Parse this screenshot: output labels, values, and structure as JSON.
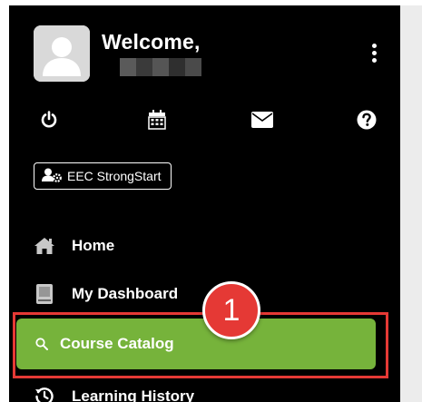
{
  "profile": {
    "greeting": "Welcome,",
    "menu_icon": "kebab-menu-icon"
  },
  "toolbar": {
    "icons": [
      "power-icon",
      "calendar-icon",
      "mail-icon",
      "help-icon"
    ]
  },
  "org_badge": {
    "label": "EEC StrongStart",
    "icon": "user-gear-icon"
  },
  "nav": {
    "items": [
      {
        "label": "Home",
        "icon": "home-icon"
      },
      {
        "label": "My Dashboard",
        "icon": "book-icon"
      },
      {
        "label": "Course Catalog",
        "icon": "search-icon",
        "active": true
      },
      {
        "label": "Learning History",
        "icon": "history-icon"
      }
    ]
  },
  "annotation": {
    "step_number": "1",
    "color": "#e53935"
  },
  "colors": {
    "sidebar_bg": "#000000",
    "active_bg": "#76b33b",
    "text": "#ffffff"
  }
}
